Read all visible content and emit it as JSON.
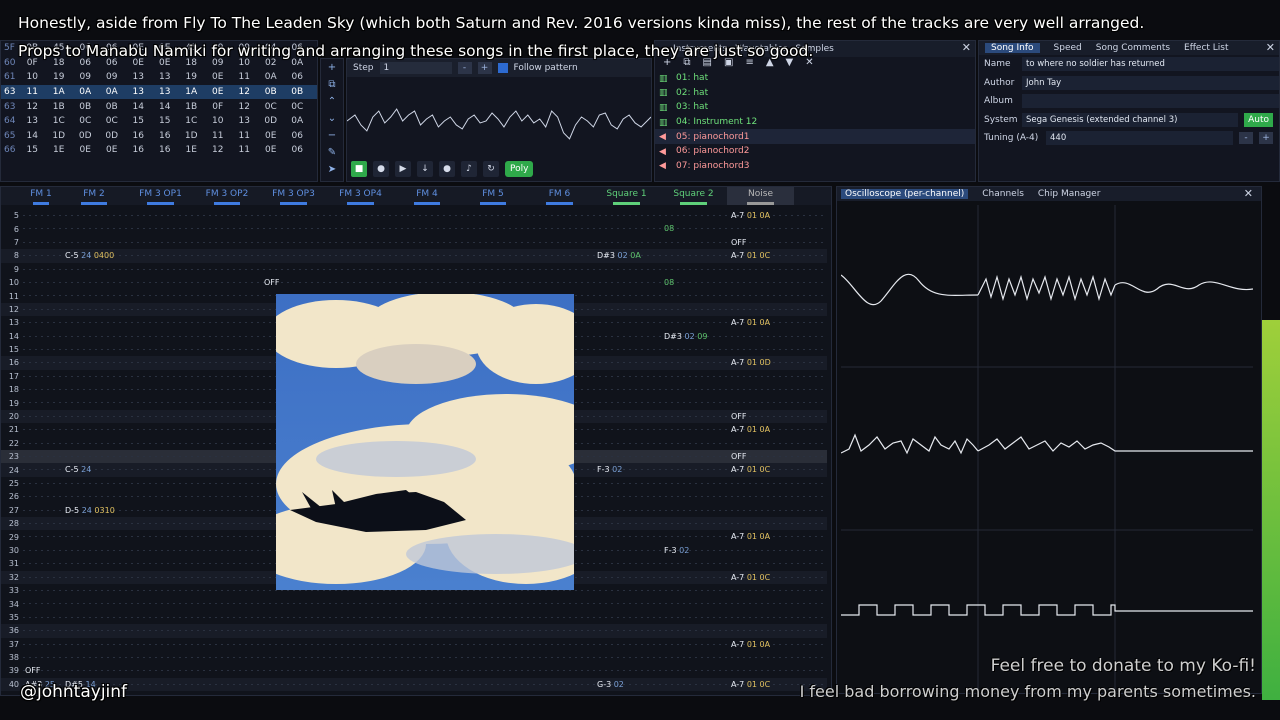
{
  "captions": {
    "line1": "Honestly, aside from Fly To The Leaden Sky (which both Saturn and Rev. 2016 versions kinda miss), the rest of the tracks are very well arranged.",
    "line2": "Props to Manabu Namiki for writing and arranging these songs in the first place, they are just so good.",
    "handle": "@johntayjinf",
    "donate1": "Feel free to donate to my Ko-fi!",
    "donate2": "I feel bad borrowing money from my parents sometimes."
  },
  "orders": [
    [
      "5F",
      "0B",
      "45",
      "06",
      "06",
      "0E",
      "0E",
      "45",
      "09",
      "09",
      "04",
      "06"
    ],
    [
      "60",
      "0F",
      "18",
      "06",
      "06",
      "0E",
      "0E",
      "18",
      "09",
      "10",
      "02",
      "0A"
    ],
    [
      "61",
      "10",
      "19",
      "09",
      "09",
      "13",
      "13",
      "19",
      "0E",
      "11",
      "0A",
      "06"
    ],
    [
      "63",
      "11",
      "1A",
      "0A",
      "0A",
      "13",
      "13",
      "1A",
      "0E",
      "12",
      "0B",
      "0B"
    ],
    [
      "63",
      "12",
      "1B",
      "0B",
      "0B",
      "14",
      "14",
      "1B",
      "0F",
      "12",
      "0C",
      "0C"
    ],
    [
      "64",
      "13",
      "1C",
      "0C",
      "0C",
      "15",
      "15",
      "1C",
      "10",
      "13",
      "0D",
      "0A"
    ],
    [
      "65",
      "14",
      "1D",
      "0D",
      "0D",
      "16",
      "16",
      "1D",
      "11",
      "11",
      "0E",
      "06"
    ],
    [
      "66",
      "15",
      "1E",
      "0E",
      "0E",
      "16",
      "16",
      "1E",
      "12",
      "11",
      "0E",
      "06"
    ]
  ],
  "orders_highlight": 3,
  "controls": {
    "step_label": "Step",
    "step_value": "1",
    "minus": "-",
    "plus": "+",
    "follow_label": "Follow pattern",
    "poly_label": "Poly"
  },
  "instruments": {
    "tabs": [
      "Instruments",
      "Wavetables",
      "Samples"
    ],
    "items": [
      {
        "label": "01: hat",
        "kind": "fm"
      },
      {
        "label": "02: hat",
        "kind": "fm"
      },
      {
        "label": "03: hat",
        "kind": "fm"
      },
      {
        "label": "04: Instrument 12",
        "kind": "fm"
      },
      {
        "label": "05: pianochord1",
        "kind": "sel"
      },
      {
        "label": "06: pianochord2",
        "kind": "snd"
      },
      {
        "label": "07: pianochord3",
        "kind": "snd"
      }
    ]
  },
  "song_info": {
    "tabs": [
      "Song Info",
      "Speed",
      "Song Comments",
      "Effect List"
    ],
    "name_label": "Name",
    "name": "to where no soldier has returned",
    "author_label": "Author",
    "author": "John Tay",
    "album_label": "Album",
    "album": "",
    "system_label": "System",
    "system": "Sega Genesis (extended channel 3)",
    "auto_label": "Auto",
    "tuning_label": "Tuning (A-4)",
    "tuning": "440"
  },
  "channels": [
    {
      "label": "FM 1",
      "cls": "fm"
    },
    {
      "label": "FM 2",
      "cls": "fm"
    },
    {
      "label": "FM 3 OP1",
      "cls": "fm"
    },
    {
      "label": "FM 3 OP2",
      "cls": "fm"
    },
    {
      "label": "FM 3 OP3",
      "cls": "fm"
    },
    {
      "label": "FM 3 OP4",
      "cls": "fm"
    },
    {
      "label": "FM 4",
      "cls": "fm"
    },
    {
      "label": "FM 5",
      "cls": "fm"
    },
    {
      "label": "FM 6",
      "cls": "fm"
    },
    {
      "label": "Square 1",
      "cls": "sq2"
    },
    {
      "label": "Square 2",
      "cls": "sq2"
    },
    {
      "label": "Noise",
      "cls": "noise"
    }
  ],
  "row_numbers": [
    "5",
    "6",
    "7",
    "8",
    "9",
    "10",
    "11",
    "12",
    "13",
    "14",
    "15",
    "16",
    "17",
    "18",
    "19",
    "20",
    "21",
    "22",
    "23",
    "24",
    "25",
    "26",
    "27",
    "28",
    "29",
    "30",
    "31",
    "32",
    "33",
    "34",
    "35",
    "36",
    "37",
    "38",
    "39",
    "40"
  ],
  "pattern_cells": [
    {
      "row": 0,
      "ch": "noise",
      "text": "A-7",
      "eff": "01 0A"
    },
    {
      "row": 1,
      "ch": "sq2",
      "text": "",
      "vol": "08"
    },
    {
      "row": 2,
      "ch": "noise",
      "text": "OFF"
    },
    {
      "row": 3,
      "ch": "fm2",
      "text": "C-5",
      "ins": "24",
      "eff": "0400"
    },
    {
      "row": 3,
      "ch": "sq1",
      "text": "D#3",
      "ins": "02",
      "vol": "0A"
    },
    {
      "row": 3,
      "ch": "noise",
      "text": "A-7",
      "eff": "01 0C"
    },
    {
      "row": 5,
      "ch": "fm5",
      "text": "OFF"
    },
    {
      "row": 5,
      "ch": "sq2",
      "text": "",
      "vol": "08"
    },
    {
      "row": 8,
      "ch": "noise",
      "text": "A-7",
      "eff": "01 0A"
    },
    {
      "row": 9,
      "ch": "sq2",
      "text": "D#3",
      "ins": "02",
      "vol": "09"
    },
    {
      "row": 11,
      "ch": "fm9",
      "text": "",
      "vol": "13"
    },
    {
      "row": 11,
      "ch": "noise",
      "text": "A-7",
      "eff": "01 0D"
    },
    {
      "row": 15,
      "ch": "noise",
      "text": "OFF"
    },
    {
      "row": 16,
      "ch": "noise",
      "text": "A-7",
      "eff": "01 0A"
    },
    {
      "row": 18,
      "ch": "noise",
      "text": "OFF"
    },
    {
      "row": 19,
      "ch": "fm2",
      "text": "C-5",
      "ins": "24"
    },
    {
      "row": 19,
      "ch": "sq1",
      "text": "F-3",
      "ins": "02"
    },
    {
      "row": 19,
      "ch": "noise",
      "text": "A-7",
      "eff": "01 0C"
    },
    {
      "row": 22,
      "ch": "fm2",
      "text": "D-5",
      "ins": "24",
      "eff": "0310"
    },
    {
      "row": 24,
      "ch": "noise",
      "text": "A-7",
      "eff": "01 0A"
    },
    {
      "row": 25,
      "ch": "sq2",
      "text": "F-3",
      "ins": "02"
    },
    {
      "row": 27,
      "ch": "noise",
      "text": "A-7",
      "eff": "01 0C"
    },
    {
      "row": 32,
      "ch": "noise",
      "text": "A-7",
      "eff": "01 0A"
    },
    {
      "row": 34,
      "ch": "fm1",
      "text": "OFF"
    },
    {
      "row": 35,
      "ch": "fm1",
      "text": "A#3",
      "ins": "25"
    },
    {
      "row": 35,
      "ch": "fm2",
      "text": "D#5",
      "ins": "14"
    },
    {
      "row": 35,
      "ch": "sq1",
      "text": "G-3",
      "ins": "02"
    },
    {
      "row": 35,
      "ch": "noise",
      "text": "A-7",
      "eff": "01 0C"
    }
  ],
  "oscilloscope": {
    "tabs": [
      "Oscilloscope (per-channel)",
      "Channels",
      "Chip Manager"
    ]
  },
  "colors": {
    "fm_accent": "#3f7be0",
    "square_accent": "#5fd07a",
    "highlight_row": "#1e3d64",
    "play_green": "#2fa94a"
  }
}
